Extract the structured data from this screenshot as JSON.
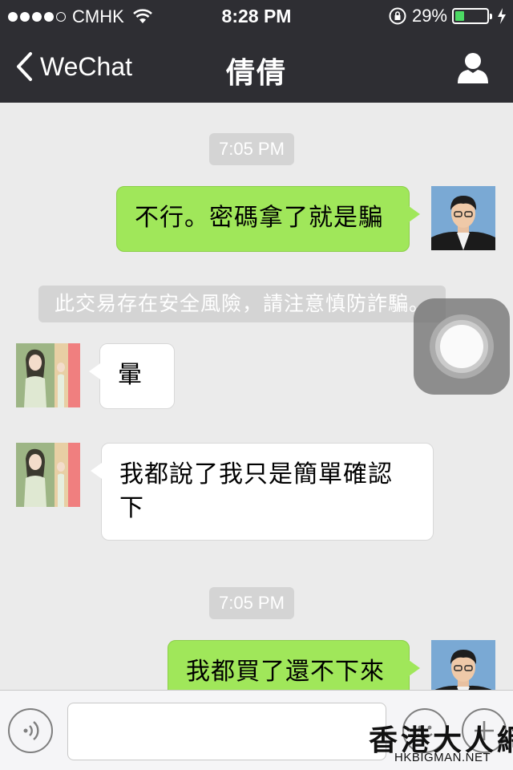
{
  "status_bar": {
    "carrier": "CMHK",
    "time": "8:28 PM",
    "battery_percent": "29%",
    "battery_level": 0.29,
    "signal_bars": 4,
    "colors": {
      "battery_fill": "#4cd964"
    },
    "icons": [
      "wifi-icon",
      "rotation-lock-icon",
      "battery-icon",
      "charging-bolt-icon"
    ]
  },
  "nav_bar": {
    "back_label": "WeChat",
    "title": "倩倩",
    "background": "#2e2e33",
    "icons": [
      "chevron-left-icon",
      "profile-icon"
    ]
  },
  "chat": {
    "time_stamp_1": "7:05 PM",
    "msg_1": {
      "sender": "me",
      "text": "不行。密碼拿了就是騙"
    },
    "system_notice": "此交易存在安全風險，請注意慎防詐騙。",
    "msg_2": {
      "sender": "them",
      "text": "暈"
    },
    "msg_3": {
      "sender": "them",
      "text_line_1": "我都說了我只是簡單確認",
      "text_line_2": "下"
    },
    "time_stamp_2": "7:05 PM",
    "msg_4": {
      "sender": "me",
      "text": "我都買了還不下來"
    },
    "colors": {
      "my_bubble": "#a0e75a",
      "their_bubble": "#ffffff",
      "background": "#ebebeb"
    }
  },
  "input_bar": {
    "icons": [
      "voice-icon",
      "emoji-icon",
      "plus-icon"
    ],
    "text_value": ""
  },
  "watermark": {
    "title": "香港大人網",
    "subtitle": "HKBIGMAN.NET"
  }
}
